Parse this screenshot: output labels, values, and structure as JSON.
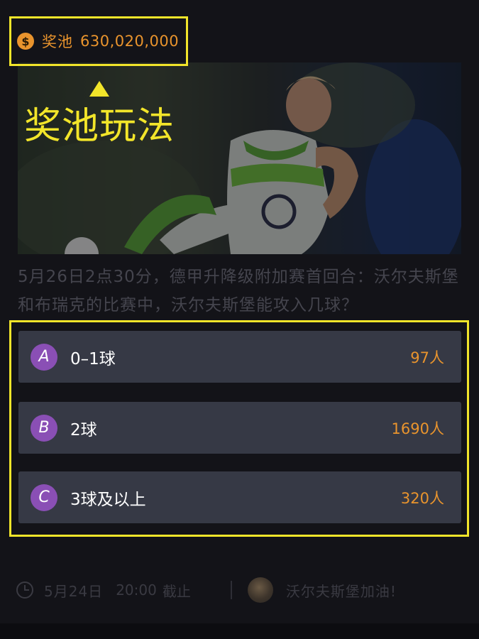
{
  "pool": {
    "icon": "dollar-coin-icon",
    "label": "奖池",
    "value": "630,020,000",
    "accent": "#e9942d"
  },
  "annotation": {
    "text": "奖池玩法",
    "color": "#f2e52a"
  },
  "question": "5月26日2点30分，德甲升降级附加赛首回合：沃尔夫斯堡和布瑞克的比赛中，沃尔夫斯堡能攻入几球？",
  "options": [
    {
      "letter": "A",
      "text": "0–1球",
      "count": "97人"
    },
    {
      "letter": "B",
      "text": "2球",
      "count": "1690人"
    },
    {
      "letter": "C",
      "text": "3球及以上",
      "count": "320人"
    }
  ],
  "footer": {
    "clock_icon": "clock-icon",
    "date": "5月24日",
    "time": "20:00",
    "deadline_label": "截止",
    "cheer": "沃尔夫斯堡加油!"
  }
}
